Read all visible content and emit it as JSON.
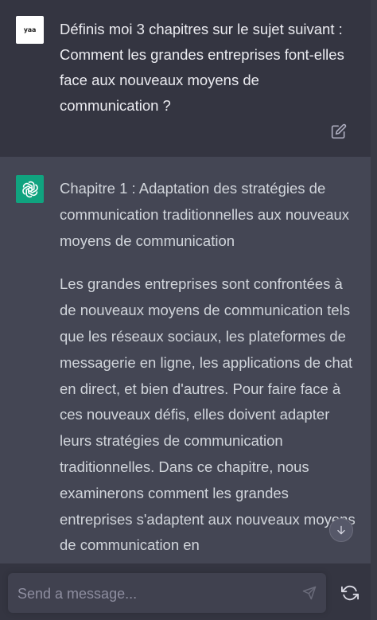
{
  "user_message": {
    "avatar_text": "yaa",
    "text": "Définis moi 3 chapitres sur le sujet suivant : Comment les grandes entreprises font-elles face aux nouveaux moyens de communication ?"
  },
  "assistant_message": {
    "heading": "Chapitre 1 : Adaptation des stratégies de communication traditionnelles aux nouveaux moyens de communication",
    "paragraph": "Les grandes entreprises sont confrontées à de nouveaux moyens de communication tels que les réseaux sociaux, les plateformes de messagerie en ligne, les applications de chat en direct, et bien d'autres. Pour faire face à ces nouveaux défis, elles doivent adapter leurs stratégies de communication traditionnelles. Dans ce chapitre, nous examinerons comment les grandes entreprises s'adaptent aux nouveaux moyens de communication en"
  },
  "composer": {
    "placeholder": "Send a message..."
  },
  "icons": {
    "edit": "edit-icon",
    "assistant_logo": "openai-logo-icon",
    "scroll_down": "arrow-down-icon",
    "send": "send-icon",
    "regenerate": "regenerate-icon"
  },
  "colors": {
    "background": "#343541",
    "assistant_background": "#444654",
    "assistant_avatar": "#10a37f",
    "text": "#ececf1",
    "placeholder": "#8e8ea0"
  }
}
